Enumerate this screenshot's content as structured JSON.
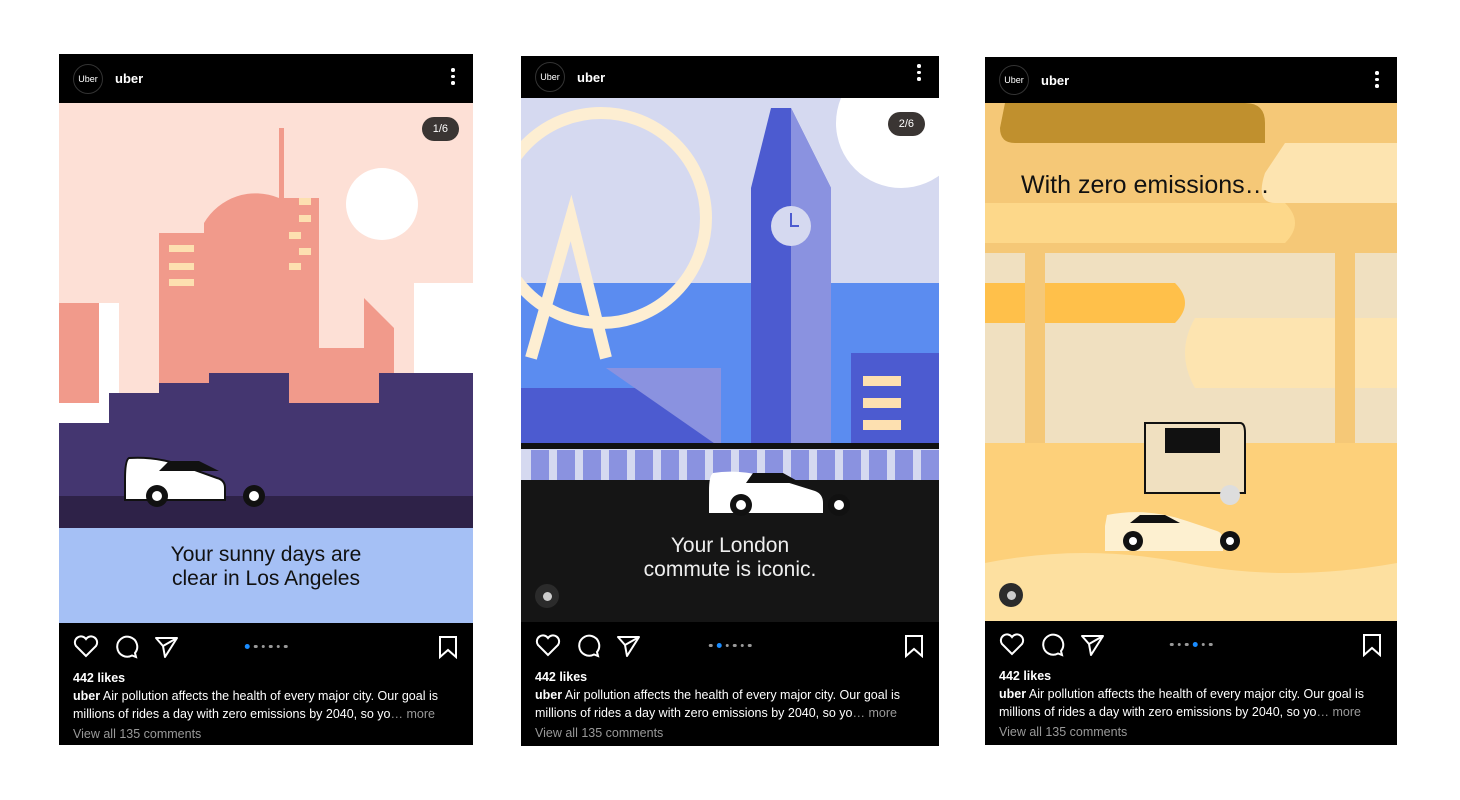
{
  "posts": [
    {
      "avatar_text": "Uber",
      "username": "uber",
      "counter": "1/6",
      "caption_lines": [
        "Your sunny days are",
        "clear in Los Angeles"
      ],
      "likes": "442 likes",
      "caption_user": "uber",
      "caption_text": " Air pollution affects the health of every major city. Our goal is millions of rides a day with zero emissions by 2040, so yo",
      "ellipsis": "… more",
      "comments": "View all 135 comments",
      "active_dot": 0
    },
    {
      "avatar_text": "Uber",
      "username": "uber",
      "counter": "2/6",
      "caption_lines": [
        "Your London",
        "commute is iconic."
      ],
      "likes": "442 likes",
      "caption_user": "uber",
      "caption_text": " Air pollution affects the health of every major city. Our goal is millions of rides a day with zero emissions by 2040, so yo",
      "ellipsis": "… more",
      "comments": "View all 135 comments",
      "active_dot": 1
    },
    {
      "avatar_text": "Uber",
      "username": "uber",
      "caption_lines": [
        "With zero emissions…"
      ],
      "likes": "442 likes",
      "caption_user": "uber",
      "caption_text": " Air pollution affects the health of every major city. Our goal is millions of rides a day with zero emissions by 2040, so yo",
      "ellipsis": "… more",
      "comments": "View all 135 comments",
      "active_dot": 3
    }
  ],
  "dot_count": 6,
  "colors": {
    "active_dot": "#1a8cff",
    "la_sky": "#fde0d6",
    "london_sky": "#d5d9f0",
    "yellow_bg": "#f5c877"
  }
}
